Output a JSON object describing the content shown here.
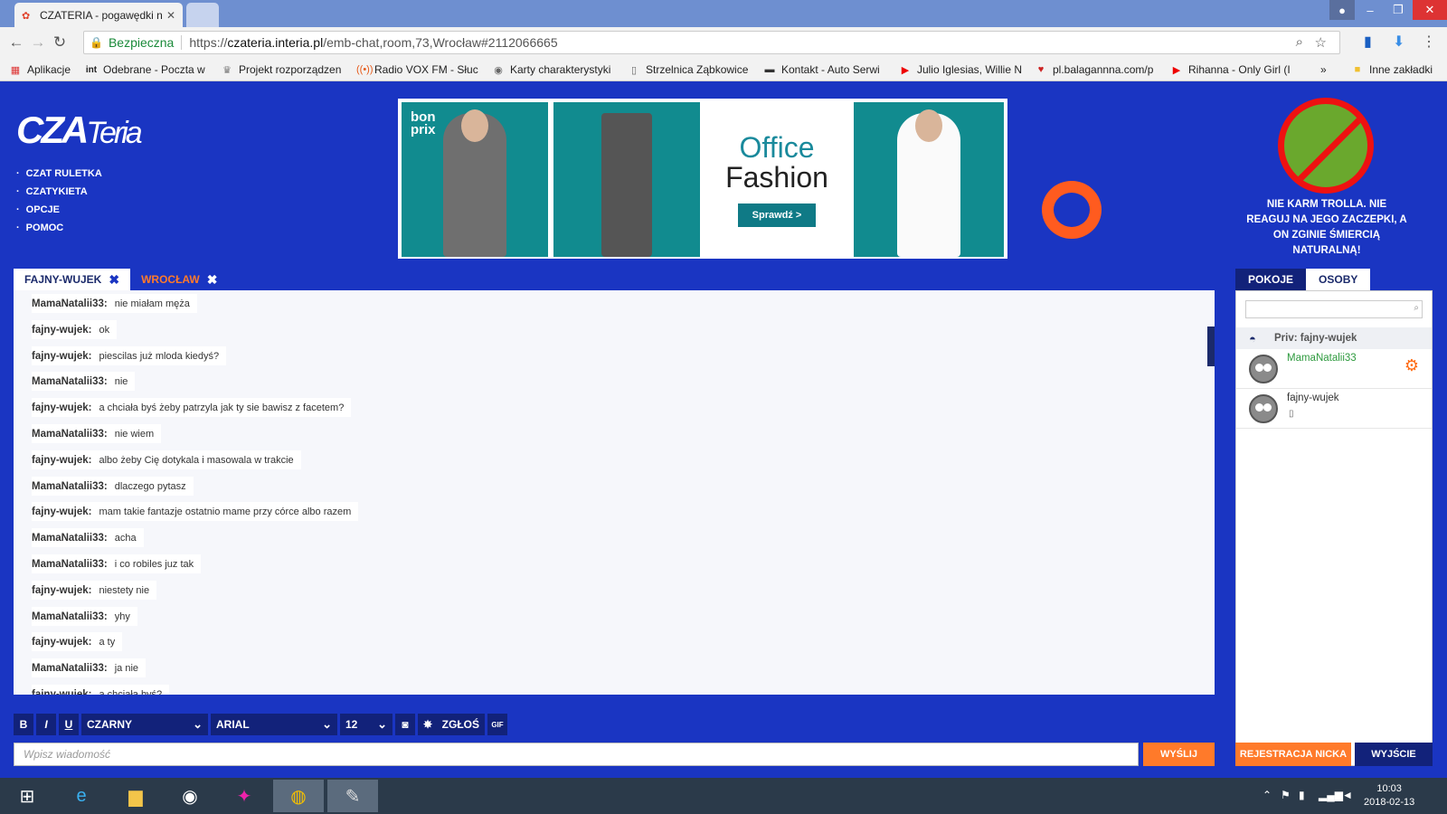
{
  "browser": {
    "tab_title": "CZATERIA - pogawędki n",
    "omnibox": {
      "secure_label": "Bezpieczna",
      "url_prefix": "https://",
      "url_host": "czateria.interia.pl",
      "url_path": "/emb-chat,room,73,Wrocław#2112066665"
    },
    "bookmarks": [
      {
        "label": "Aplikacje",
        "icon": "apps-grid-icon"
      },
      {
        "label": "Odebrane - Poczta w",
        "icon": "int-icon"
      },
      {
        "label": "Projekt rozporządzen",
        "icon": "eagle-icon"
      },
      {
        "label": "Radio VOX FM - Słuc",
        "icon": "radio-icon"
      },
      {
        "label": "Karty charakterystyki",
        "icon": "globe-icon"
      },
      {
        "label": "Strzelnica Ząbkowice",
        "icon": "page-icon"
      },
      {
        "label": "Kontakt - Auto Serwi",
        "icon": "car-icon"
      },
      {
        "label": "Julio Iglesias, Willie N",
        "icon": "youtube-icon"
      },
      {
        "label": "pl.balagannna.com/p",
        "icon": "heart-icon"
      },
      {
        "label": "Rihanna - Only Girl (I",
        "icon": "youtube-icon"
      }
    ],
    "more_bookmarks": "»",
    "other_bookmarks": "Inne zakładki"
  },
  "site": {
    "logo_main": "CZA",
    "logo_tail": "Teria",
    "menu": [
      "CZAT RULETKA",
      "CZATYKIETA",
      "OPCJE",
      "POMOC"
    ],
    "ad": {
      "brand_line1": "bon",
      "brand_line2": "prix",
      "headline1": "Office",
      "headline2": "Fashion",
      "cta": "Sprawdź >"
    },
    "troll_warning": "NIE KARM TROLLA. NIE REAGUJ NA JEGO ZACZEPKI, A ON ZGINIE ŚMIERCIĄ NATURALNĄ!"
  },
  "chat": {
    "tabs": [
      {
        "label": "FAJNY-WUJEK",
        "close": "✖"
      },
      {
        "label": "WROCŁAW",
        "close": "✖"
      }
    ],
    "messages": [
      {
        "nick": "MamaNatalii33:",
        "text": "nie miałam męża"
      },
      {
        "nick": "fajny-wujek:",
        "text": "ok"
      },
      {
        "nick": "fajny-wujek:",
        "text": "piescilas już mloda kiedyś?"
      },
      {
        "nick": "MamaNatalii33:",
        "text": "nie"
      },
      {
        "nick": "fajny-wujek:",
        "text": "a chciała byś żeby patrzyla jak ty sie bawisz z facetem?"
      },
      {
        "nick": "MamaNatalii33:",
        "text": "nie wiem"
      },
      {
        "nick": "fajny-wujek:",
        "text": "albo żeby Cię dotykala i masowala w trakcie"
      },
      {
        "nick": "MamaNatalii33:",
        "text": "dlaczego pytasz"
      },
      {
        "nick": "fajny-wujek:",
        "text": "mam takie fantazje ostatnio mame przy córce albo razem"
      },
      {
        "nick": "MamaNatalii33:",
        "text": "acha"
      },
      {
        "nick": "MamaNatalii33:",
        "text": "i co robiles juz tak"
      },
      {
        "nick": "fajny-wujek:",
        "text": "niestety nie"
      },
      {
        "nick": "MamaNatalii33:",
        "text": "yhy"
      },
      {
        "nick": "fajny-wujek:",
        "text": "a ty"
      },
      {
        "nick": "MamaNatalii33:",
        "text": "ja nie"
      },
      {
        "nick": "fajny-wujek:",
        "text": "a chciała byś?"
      }
    ],
    "toolbar": {
      "bold": "B",
      "italic": "I",
      "underline": "U",
      "color_value": "CZARNY",
      "font_value": "ARIAL",
      "size_value": "12",
      "report_label": "ZGŁOŚ",
      "gif_label": "GIF"
    },
    "input_placeholder": "Wpisz wiadomość",
    "send_label": "WYŚLIJ"
  },
  "side": {
    "tabs": [
      "POKOJE",
      "OSOBY"
    ],
    "priv_label": "Priv: fajny-wujek",
    "users": [
      {
        "name": "MamaNatalii33",
        "color": "#2e9a3e"
      },
      {
        "name": "fajny-wujek",
        "color": "#333333"
      }
    ],
    "register_label": "REJESTRACJA NICKA",
    "exit_label": "WYJŚCIE"
  },
  "taskbar": {
    "time": "10:03",
    "date": "2018-02-13"
  },
  "colors": {
    "page_bg": "#1a35c2",
    "accent_orange": "#ff7a2a",
    "dark_blue": "#12227a"
  }
}
